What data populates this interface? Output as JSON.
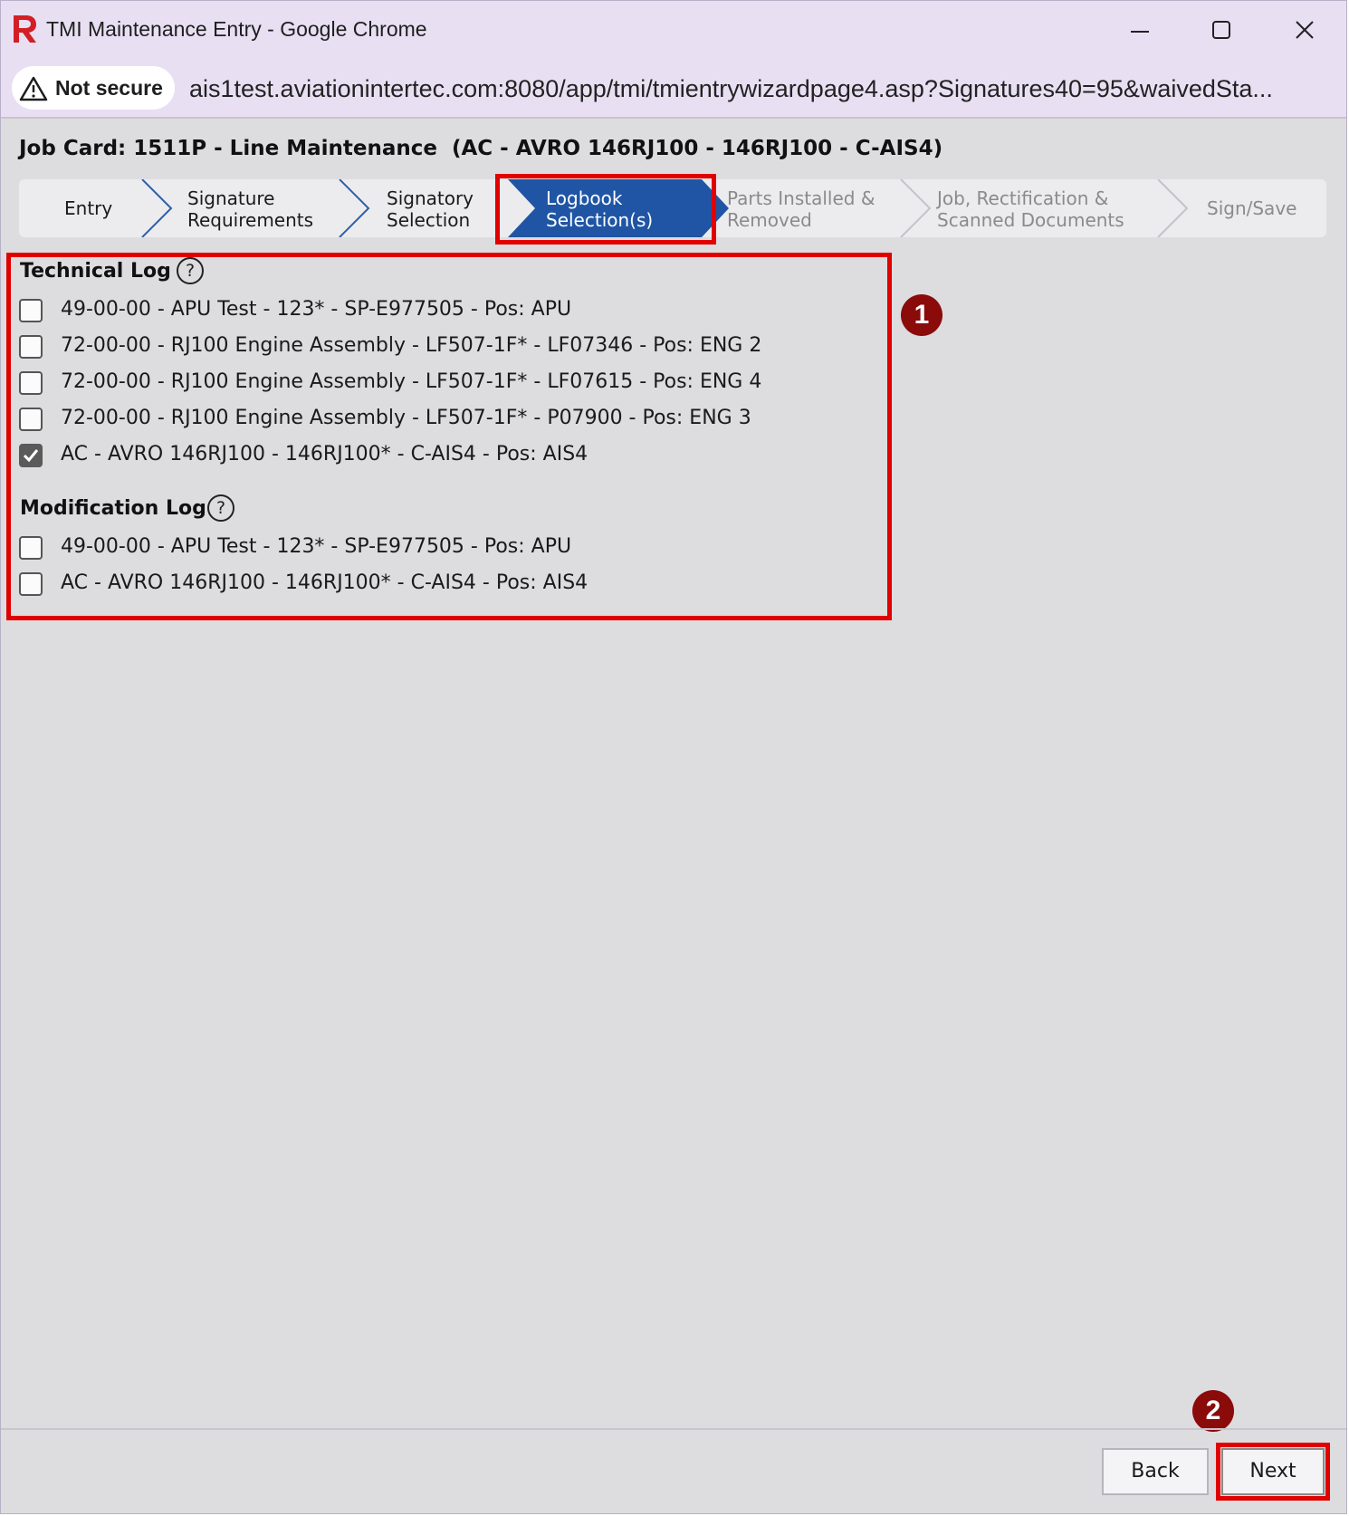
{
  "window": {
    "title": "TMI Maintenance Entry - Google Chrome",
    "security_label": "Not secure",
    "url": "ais1test.aviationintertec.com:8080/app/tmi/tmientrywizardpage4.asp?Signatures40=95&waivedSta..."
  },
  "job_card": {
    "title": "Job Card: 1511P - Line Maintenance  (AC - AVRO 146RJ100 - 146RJ100 - C-AIS4)"
  },
  "wizard": {
    "steps": [
      {
        "label": "Entry",
        "state": "done"
      },
      {
        "label": "Signature\nRequirements",
        "state": "done"
      },
      {
        "label": "Signatory\nSelection",
        "state": "done"
      },
      {
        "label": "Logbook\nSelection(s)",
        "state": "active"
      },
      {
        "label": "Parts Installed &\nRemoved",
        "state": "future"
      },
      {
        "label": "Job, Rectification &\nScanned Documents",
        "state": "future"
      },
      {
        "label": "Sign/Save",
        "state": "future"
      }
    ],
    "active_color": "#1f55a4"
  },
  "technical_log": {
    "title": "Technical Log",
    "help": "?",
    "items": [
      {
        "label": "49-00-00 - APU Test - 123* - SP-E977505 - Pos: APU",
        "checked": false
      },
      {
        "label": "72-00-00 - RJ100 Engine Assembly - LF507-1F* - LF07346 - Pos: ENG 2",
        "checked": false
      },
      {
        "label": "72-00-00 - RJ100 Engine Assembly - LF507-1F* - LF07615 - Pos: ENG 4",
        "checked": false
      },
      {
        "label": "72-00-00 - RJ100 Engine Assembly - LF507-1F* - P07900 - Pos: ENG 3",
        "checked": false
      },
      {
        "label": "AC - AVRO 146RJ100 - 146RJ100* - C-AIS4 - Pos: AIS4",
        "checked": true
      }
    ]
  },
  "modification_log": {
    "title": "Modification Log",
    "help": "?",
    "items": [
      {
        "label": "49-00-00 - APU Test - 123* - SP-E977505 - Pos: APU",
        "checked": false
      },
      {
        "label": "AC - AVRO 146RJ100 - 146RJ100* - C-AIS4 - Pos: AIS4",
        "checked": false
      }
    ]
  },
  "callouts": {
    "one": "1",
    "two": "2"
  },
  "footer": {
    "back_label": "Back",
    "next_label": "Next"
  },
  "colors": {
    "highlight": "#e00000",
    "callout": "#8b0a0a"
  }
}
